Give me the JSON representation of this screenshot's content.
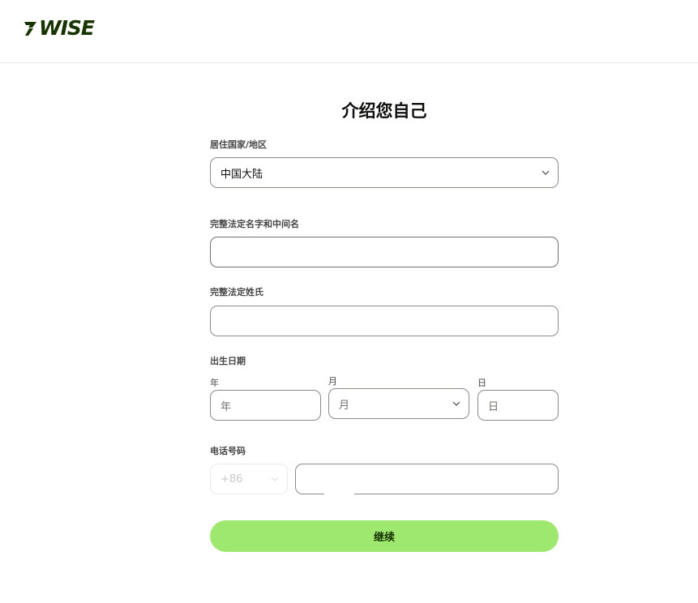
{
  "brand": {
    "logo_text": "WISE",
    "logo_color": "#163300"
  },
  "form": {
    "title": "介绍您自己",
    "country": {
      "label": "居住国家/地区",
      "value": "中国大陆"
    },
    "first_name": {
      "label": "完整法定名字和中间名",
      "value": ""
    },
    "last_name": {
      "label": "完整法定姓氏",
      "value": ""
    },
    "dob": {
      "label": "出生日期",
      "year": {
        "label": "年",
        "placeholder": "年"
      },
      "month": {
        "label": "月",
        "placeholder": "月"
      },
      "day": {
        "label": "日",
        "placeholder": "日"
      }
    },
    "phone": {
      "label": "电话号码",
      "code": "+86",
      "value": ""
    },
    "submit_label": "继续"
  },
  "colors": {
    "accent": "#9fe870",
    "text": "#0e0f0c",
    "border": "#8a8c88"
  },
  "icons": {
    "logo": "wise-flag-icon",
    "dropdown": "chevron-down-icon"
  }
}
